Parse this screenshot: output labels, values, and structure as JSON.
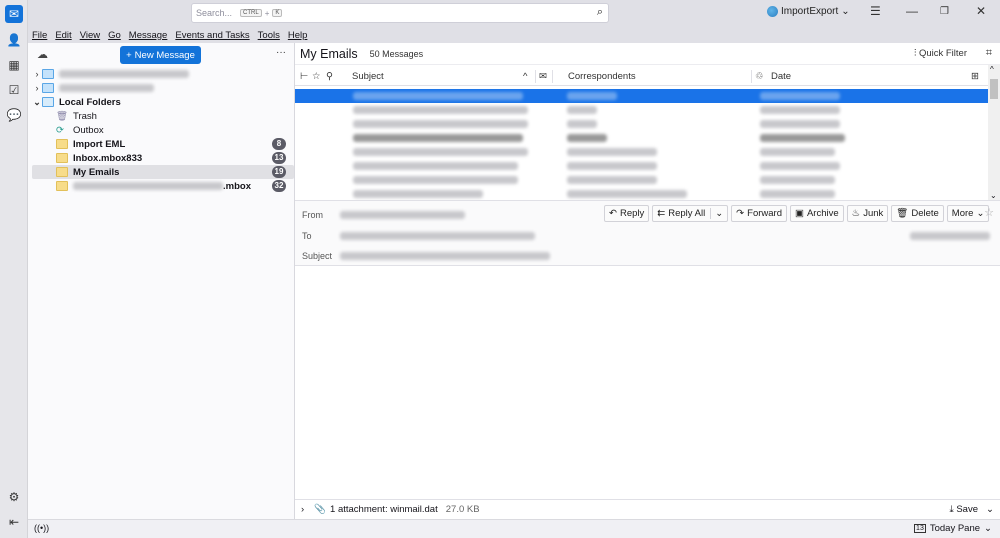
{
  "titlebar": {
    "search_placeholder": "Search...",
    "shortcut_key1": "CTRL",
    "shortcut_plus": "+",
    "shortcut_key2": "K",
    "account_name": "ImportExport"
  },
  "menu": [
    "File",
    "Edit",
    "View",
    "Go",
    "Message",
    "Events and Tasks",
    "Tools",
    "Help"
  ],
  "folder_pane": {
    "new_message_label": "New Message",
    "folders": [
      {
        "name": "Local Folders",
        "bold": true
      },
      {
        "name": "Trash"
      },
      {
        "name": "Outbox"
      },
      {
        "name": "Import EML",
        "count": "8",
        "bold": true
      },
      {
        "name": "Inbox.mbox833",
        "count": "13",
        "bold": true
      },
      {
        "name": "My Emails",
        "count": "19",
        "bold": true,
        "selected": true
      },
      {
        "name_suffix": ".mbox",
        "count": "32",
        "bold": true
      }
    ]
  },
  "message_list": {
    "folder_title": "My Emails",
    "message_count": "50 Messages",
    "quick_filter": "Quick Filter",
    "columns": {
      "subject": "Subject",
      "correspondents": "Correspondents",
      "date": "Date"
    }
  },
  "message_header": {
    "from_label": "From",
    "to_label": "To",
    "subject_label": "Subject",
    "buttons": {
      "reply": "Reply",
      "reply_all": "Reply All",
      "forward": "Forward",
      "archive": "Archive",
      "junk": "Junk",
      "delete": "Delete",
      "more": "More"
    }
  },
  "attachments": {
    "summary": "1 attachment: winmail.dat",
    "size": "27.0 KB",
    "save": "Save"
  },
  "status_bar": {
    "today_pane": "Today Pane",
    "today_date": "13"
  }
}
